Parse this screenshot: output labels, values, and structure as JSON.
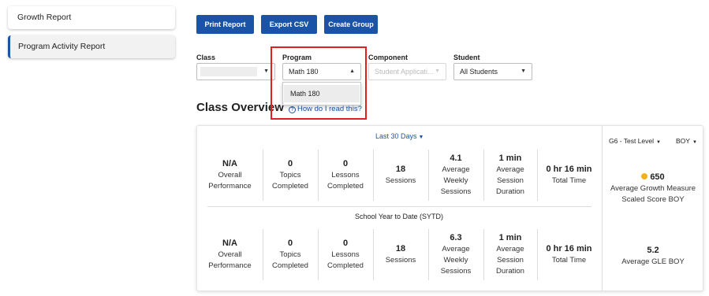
{
  "sidebar": {
    "items": [
      {
        "label": "Growth Report"
      },
      {
        "label": "Program Activity Report"
      }
    ]
  },
  "toolbar": {
    "print_label": "Print Report",
    "export_label": "Export CSV",
    "create_group_label": "Create Group"
  },
  "filters": {
    "class": {
      "label": "Class",
      "value": ""
    },
    "program": {
      "label": "Program",
      "value": "Math 180",
      "options": [
        "Math 180"
      ]
    },
    "component": {
      "label": "Component",
      "placeholder": "Student Applicati..."
    },
    "student": {
      "label": "Student",
      "value": "All Students"
    }
  },
  "overview": {
    "title": "Class Overview",
    "help_link": "How do I read this?",
    "period": "Last 30 Days",
    "sytd_label": "School Year to Date (SYTD)",
    "last30": [
      {
        "value": "N/A",
        "label": "Overall Performance"
      },
      {
        "value": "0",
        "label": "Topics Completed"
      },
      {
        "value": "0",
        "label": "Lessons Completed"
      },
      {
        "value": "18",
        "label": "Sessions"
      },
      {
        "value": "4.1",
        "label": "Average Weekly Sessions"
      },
      {
        "value": "1 min",
        "label": "Average Session Duration"
      },
      {
        "value": "0 hr 16 min",
        "label": "Total Time"
      }
    ],
    "sytd": [
      {
        "value": "N/A",
        "label": "Overall Performance"
      },
      {
        "value": "0",
        "label": "Topics Completed"
      },
      {
        "value": "0",
        "label": "Lessons Completed"
      },
      {
        "value": "18",
        "label": "Sessions"
      },
      {
        "value": "6.3",
        "label": "Average Weekly Sessions"
      },
      {
        "value": "1 min",
        "label": "Average Session Duration"
      },
      {
        "value": "0 hr 16 min",
        "label": "Total Time"
      }
    ],
    "side": {
      "test_level": "G6 - Test Level",
      "term": "BOY",
      "growth_value": "650",
      "growth_label": "Average Growth Measure Scaled Score BOY",
      "gle_value": "5.2",
      "gle_label": "Average GLE BOY"
    }
  },
  "colors": {
    "accent": "#1a54a6",
    "highlight": "#e02020",
    "growth_dot": "#f2b21b"
  }
}
